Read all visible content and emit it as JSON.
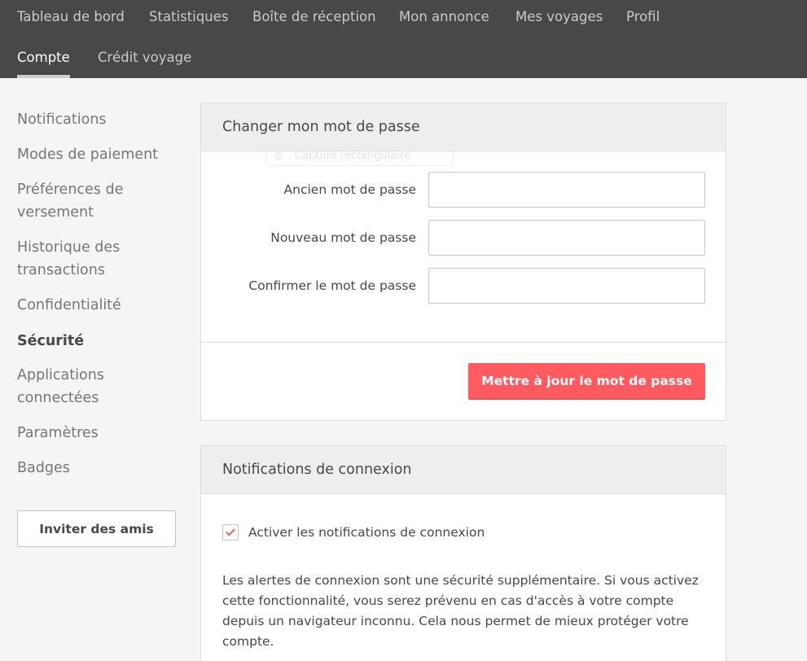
{
  "topnav": {
    "main": [
      {
        "label": "Tableau de bord"
      },
      {
        "label": "Statistiques"
      },
      {
        "label": "Boîte de réception"
      },
      {
        "label": "Mon annonce"
      },
      {
        "label": "Mes voyages"
      },
      {
        "label": "Profil"
      }
    ],
    "sub": [
      {
        "label": "Compte",
        "active": true
      },
      {
        "label": "Crédit voyage",
        "active": false
      }
    ]
  },
  "sidebar": {
    "items": [
      {
        "label": "Notifications"
      },
      {
        "label": "Modes de paiement"
      },
      {
        "label": "Préférences de versement"
      },
      {
        "label": "Historique des transactions"
      },
      {
        "label": "Confidentialité"
      },
      {
        "label": "Sécurité",
        "active": true
      },
      {
        "label": "Applications connectées"
      },
      {
        "label": "Paramètres"
      },
      {
        "label": "Badges"
      }
    ],
    "invite_label": "Inviter des amis"
  },
  "password_panel": {
    "title": "Changer mon mot de passe",
    "ghost_text": "Capture rectangulaire",
    "fields": [
      {
        "label": "Ancien mot de passe",
        "value": "",
        "placeholder": ""
      },
      {
        "label": "Nouveau mot de passe",
        "value": "",
        "placeholder": ""
      },
      {
        "label": "Confirmer le mot de passe",
        "value": "",
        "placeholder": ""
      }
    ],
    "submit_label": "Mettre à jour le mot de passe"
  },
  "login_notifications": {
    "title": "Notifications de connexion",
    "checkbox_label": "Activer les notifications de connexion",
    "checked": true,
    "description": "Les alertes de connexion sont une sécurité supplémentaire. Si vous activez cette fonctionnalité, vous serez prévenu en cas d'accès à votre compte depuis un navigateur inconnu. Cela nous permet de mieux protéger votre compte."
  },
  "colors": {
    "topbar": "#484848",
    "accent": "#ff5a5f",
    "background": "#f5f5f5"
  }
}
